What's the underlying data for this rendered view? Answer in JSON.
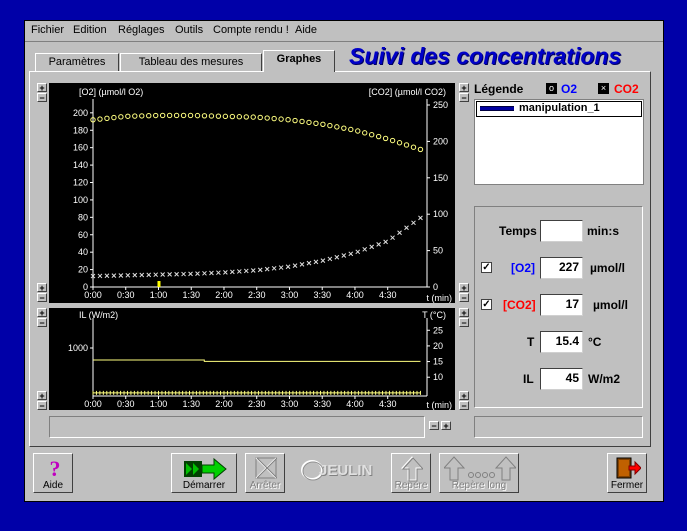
{
  "app_title": "Suivi des concentrations",
  "menu": [
    "Fichier",
    "Edition",
    "Réglages",
    "Outils",
    "Compte rendu !",
    "Aide"
  ],
  "tabs": [
    {
      "label": "Paramètres",
      "active": false
    },
    {
      "label": "Tableau des mesures",
      "active": false
    },
    {
      "label": "Graphes",
      "active": true
    }
  ],
  "legend": {
    "title": "Légende",
    "o2_label": "O2",
    "co2_label": "CO2",
    "o2_color": "#0000ff",
    "co2_color": "#ff0000",
    "entries": [
      "manipulation_1"
    ]
  },
  "readings": {
    "temps_label": "Temps",
    "temps_value": "",
    "temps_unit": "min:s",
    "o2_label": "[O2]",
    "o2_value": "227",
    "o2_unit": "µmol/l",
    "o2_checked": true,
    "co2_label": "[CO2]",
    "co2_value": "17",
    "co2_unit": "µmol/l",
    "co2_checked": true,
    "t_label": "T",
    "t_value": "15.4",
    "t_unit": "°C",
    "il_label": "IL",
    "il_value": "45",
    "il_unit": "W/m2"
  },
  "toolbar": {
    "aide": "Aide",
    "demarrer": "Démarrer",
    "arreter": "Arrêter",
    "brand": "JEULIN",
    "repere": "Repère",
    "repere_long": "Repère long",
    "fermer": "Fermer"
  },
  "chart_data": [
    {
      "type": "scatter",
      "x_ticks": [
        "0:00",
        "0:30",
        "1:00",
        "1:30",
        "2:00",
        "2:30",
        "3:00",
        "3:30",
        "4:00",
        "4:30"
      ],
      "xlabel": "t (min)",
      "ylabel": "[O2] (µmol/l O2)",
      "ylabel_right": "[CO2] (µmol/l CO2)",
      "y_ticks": [
        0,
        20,
        40,
        60,
        80,
        100,
        120,
        140,
        160,
        180,
        200
      ],
      "y_ticks_right": [
        0,
        50,
        100,
        150,
        200,
        250
      ],
      "xlim": [
        0,
        5.1
      ],
      "ylim": [
        0,
        209
      ],
      "ylim_right": [
        0,
        250
      ],
      "series": [
        {
          "name": "O2",
          "marker": "o",
          "color": "#ffff80",
          "axis": "left",
          "x": [
            0.0,
            0.5,
            1.0,
            1.5,
            2.0,
            2.5,
            3.0,
            3.5,
            4.0,
            4.5,
            5.0
          ],
          "y": [
            192,
            196,
            197,
            197,
            196,
            195,
            192,
            187,
            180,
            170,
            158
          ]
        },
        {
          "name": "CO2",
          "marker": "x",
          "color": "#e0e0e0",
          "axis": "right",
          "x": [
            0.0,
            0.5,
            1.0,
            1.5,
            2.0,
            2.5,
            3.0,
            3.5,
            4.0,
            4.5,
            5.0
          ],
          "y": [
            15,
            16,
            17,
            18,
            20,
            23,
            28,
            36,
            47,
            63,
            95
          ]
        }
      ]
    },
    {
      "type": "line",
      "x_ticks": [
        "0:00",
        "0:30",
        "1:00",
        "1:30",
        "2:00",
        "2:30",
        "3:00",
        "3:30",
        "4:00",
        "4:30"
      ],
      "xlabel": "t (min)",
      "ylabel": "IL (W/m2)",
      "ylabel_right": "T (°C)",
      "y_ticks": [
        1000
      ],
      "y_ticks_right": [
        10.0,
        15.0,
        20.0,
        25.0
      ],
      "xlim": [
        0,
        5.1
      ],
      "ylim": [
        0,
        1500
      ],
      "ylim_right": [
        4,
        27
      ],
      "series": [
        {
          "name": "IL",
          "color": "#ffff80",
          "axis": "left",
          "x": [
            0.0,
            1.7,
            1.7,
            5.0
          ],
          "y": [
            750,
            750,
            720,
            720
          ]
        },
        {
          "name": "T",
          "color": "#ffff80",
          "axis": "right",
          "x": [
            0.0,
            5.0
          ],
          "y": [
            5.0,
            5.0
          ]
        }
      ]
    }
  ]
}
